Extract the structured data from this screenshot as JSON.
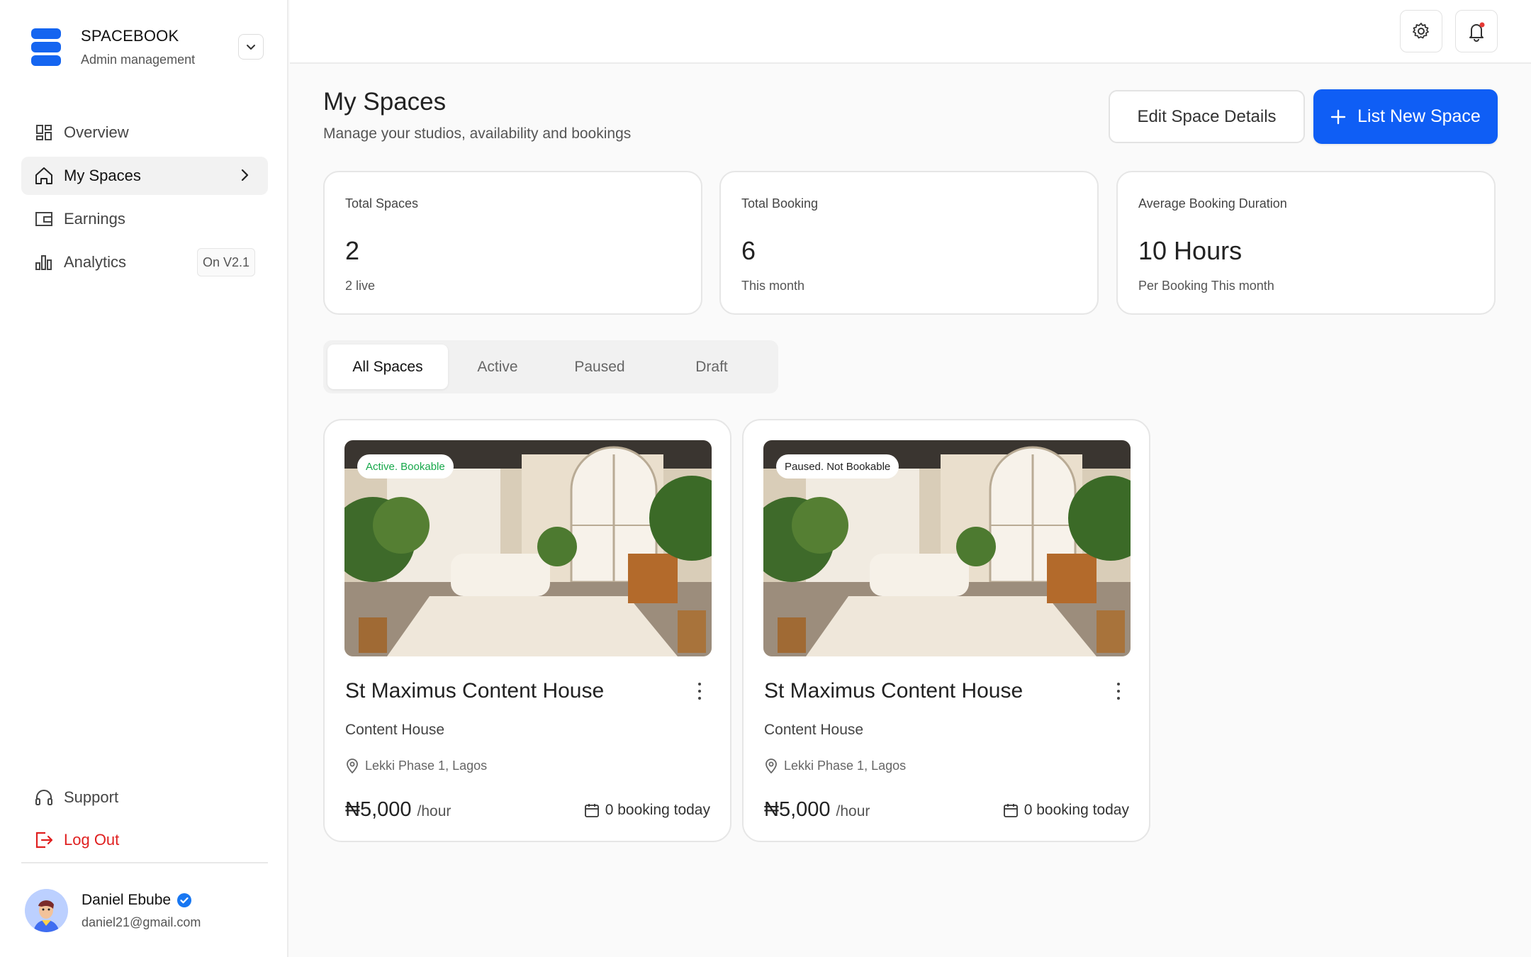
{
  "brand": {
    "name": "SPACEBOOK",
    "subtitle": "Admin management",
    "accent": "#1565f0"
  },
  "sidebar": {
    "items": [
      {
        "label": "Overview",
        "icon": "grid-icon"
      },
      {
        "label": "My Spaces",
        "icon": "home-icon",
        "active": true
      },
      {
        "label": "Earnings",
        "icon": "wallet-icon"
      },
      {
        "label": "Analytics",
        "icon": "bar-chart-icon",
        "badge": "On V2.1"
      }
    ],
    "bottom": [
      {
        "label": "Support",
        "icon": "headset-icon"
      },
      {
        "label": "Log Out",
        "icon": "logout-icon",
        "color": "#e02020"
      }
    ]
  },
  "user": {
    "name": "Daniel Ebube",
    "email": "daniel21@gmail.com"
  },
  "header": {
    "title": "My Spaces",
    "subtitle": "Manage your studios, availability and bookings",
    "edit_label": "Edit Space Details",
    "new_label": "List New Space",
    "primary_color": "#0f5ef5"
  },
  "stats": [
    {
      "label": "Total Spaces",
      "value": "2",
      "note": "2 live"
    },
    {
      "label": "Total Booking",
      "value": "6",
      "note": "This month"
    },
    {
      "label": "Average Booking Duration",
      "value": "10 Hours",
      "note": "Per Booking This month"
    }
  ],
  "tabs": [
    {
      "label": "All Spaces",
      "active": true
    },
    {
      "label": "Active"
    },
    {
      "label": "Paused"
    },
    {
      "label": "Draft"
    }
  ],
  "spaces": [
    {
      "status": "Active. Bookable",
      "status_color": "#17a84a",
      "title": "St Maximus Content House",
      "type": "Content House",
      "location": "Lekki Phase 1, Lagos",
      "price": "₦5,000",
      "unit": "/hour",
      "bookings": "0 booking today"
    },
    {
      "status": "Paused. Not Bookable",
      "status_color": "#222222",
      "title": "St Maximus Content House",
      "type": "Content House",
      "location": "Lekki Phase 1, Lagos",
      "price": "₦5,000",
      "unit": "/hour",
      "bookings": "0 booking today"
    }
  ]
}
